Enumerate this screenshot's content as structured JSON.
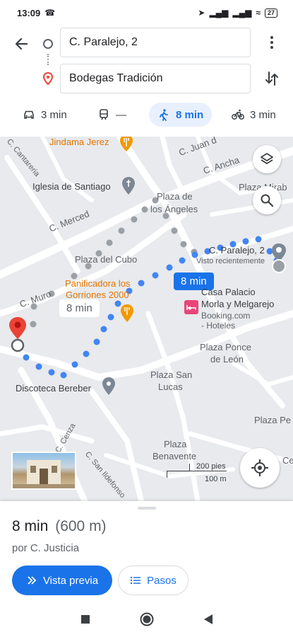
{
  "status": {
    "time": "13:09",
    "battery": "27"
  },
  "route": {
    "origin": "C. Paralejo, 2",
    "destination": "Bodegas Tradición"
  },
  "modes": [
    {
      "name": "car",
      "label": "3 min"
    },
    {
      "name": "transit",
      "label": "—"
    },
    {
      "name": "walk",
      "label": "8 min"
    },
    {
      "name": "bike",
      "label": "3 min"
    }
  ],
  "map": {
    "labels": {
      "jindama": "Jindama Jerez",
      "c_juan": "C. Juan d",
      "cantareria": "C. Cantareria",
      "c_ancha": "C. Ancha",
      "iglesia": "Iglesia de Santiago",
      "plaza_angeles_1": "Plaza de",
      "plaza_angeles_2": "los Ángeles",
      "plaza_mirab": "Plaza Mirab",
      "c_merced": "C. Merced",
      "c_paralejo": "C. Paralejo, 2",
      "visto": "Visto recientemente",
      "plaza_cubo": "Plaza del Cubo",
      "panificadora_1": "Panificadora los",
      "panificadora_2": "Gorriones 2000",
      "c_muro": "C. Muro",
      "casa_1": "Casa Palacio",
      "casa_2": "Morla y Melgarejo",
      "casa_3": "Booking.com",
      "casa_4": "- Hoteles",
      "ponce_1": "Plaza Ponce",
      "ponce_2": "de León",
      "discoteca": "Discoteca Bereber",
      "san_lucas_1": "Plaza San",
      "san_lucas_2": "Lucas",
      "plaza_pe": "Plaza Pe",
      "cenza": "C. Cenza",
      "san_ildefonso": "C. San Ildefonso",
      "benavente_1": "Plaza",
      "benavente_2": "Benavente",
      "ce": "Ce"
    },
    "duration_main": "8 min",
    "duration_alt": "8 min",
    "scale_feet": "200 pies",
    "scale_m": "100 m"
  },
  "summary": {
    "time": "8 min",
    "distance": "(600 m)",
    "via": "por C. Justicia",
    "preview_label": "Vista previa",
    "steps_label": "Pasos"
  },
  "colors": {
    "accent": "#1a73e8",
    "pin": "#ea4335",
    "map_bg": "#e8eaed"
  }
}
